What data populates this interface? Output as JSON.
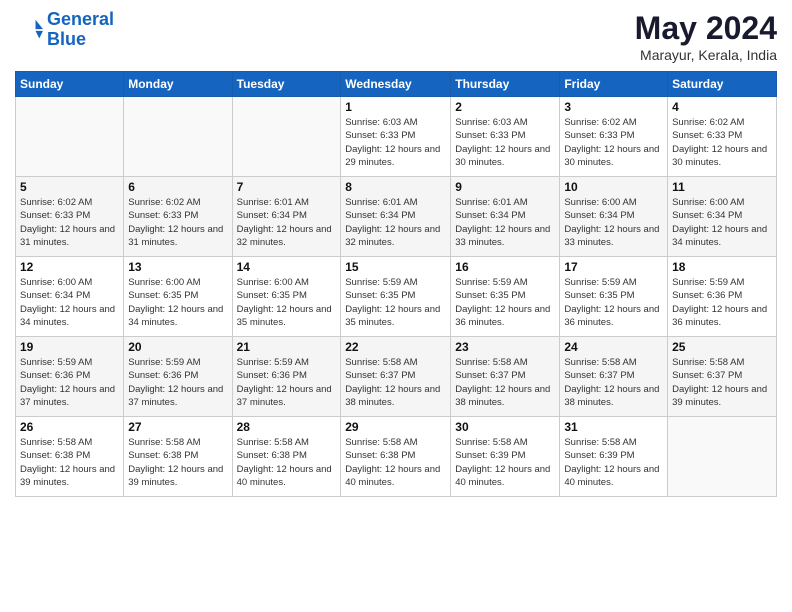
{
  "header": {
    "logo_line1": "General",
    "logo_line2": "Blue",
    "month_year": "May 2024",
    "location": "Marayur, Kerala, India"
  },
  "days_of_week": [
    "Sunday",
    "Monday",
    "Tuesday",
    "Wednesday",
    "Thursday",
    "Friday",
    "Saturday"
  ],
  "weeks": [
    [
      {
        "day": "",
        "info": ""
      },
      {
        "day": "",
        "info": ""
      },
      {
        "day": "",
        "info": ""
      },
      {
        "day": "1",
        "info": "Sunrise: 6:03 AM\nSunset: 6:33 PM\nDaylight: 12 hours\nand 29 minutes."
      },
      {
        "day": "2",
        "info": "Sunrise: 6:03 AM\nSunset: 6:33 PM\nDaylight: 12 hours\nand 30 minutes."
      },
      {
        "day": "3",
        "info": "Sunrise: 6:02 AM\nSunset: 6:33 PM\nDaylight: 12 hours\nand 30 minutes."
      },
      {
        "day": "4",
        "info": "Sunrise: 6:02 AM\nSunset: 6:33 PM\nDaylight: 12 hours\nand 30 minutes."
      }
    ],
    [
      {
        "day": "5",
        "info": "Sunrise: 6:02 AM\nSunset: 6:33 PM\nDaylight: 12 hours\nand 31 minutes."
      },
      {
        "day": "6",
        "info": "Sunrise: 6:02 AM\nSunset: 6:33 PM\nDaylight: 12 hours\nand 31 minutes."
      },
      {
        "day": "7",
        "info": "Sunrise: 6:01 AM\nSunset: 6:34 PM\nDaylight: 12 hours\nand 32 minutes."
      },
      {
        "day": "8",
        "info": "Sunrise: 6:01 AM\nSunset: 6:34 PM\nDaylight: 12 hours\nand 32 minutes."
      },
      {
        "day": "9",
        "info": "Sunrise: 6:01 AM\nSunset: 6:34 PM\nDaylight: 12 hours\nand 33 minutes."
      },
      {
        "day": "10",
        "info": "Sunrise: 6:00 AM\nSunset: 6:34 PM\nDaylight: 12 hours\nand 33 minutes."
      },
      {
        "day": "11",
        "info": "Sunrise: 6:00 AM\nSunset: 6:34 PM\nDaylight: 12 hours\nand 34 minutes."
      }
    ],
    [
      {
        "day": "12",
        "info": "Sunrise: 6:00 AM\nSunset: 6:34 PM\nDaylight: 12 hours\nand 34 minutes."
      },
      {
        "day": "13",
        "info": "Sunrise: 6:00 AM\nSunset: 6:35 PM\nDaylight: 12 hours\nand 34 minutes."
      },
      {
        "day": "14",
        "info": "Sunrise: 6:00 AM\nSunset: 6:35 PM\nDaylight: 12 hours\nand 35 minutes."
      },
      {
        "day": "15",
        "info": "Sunrise: 5:59 AM\nSunset: 6:35 PM\nDaylight: 12 hours\nand 35 minutes."
      },
      {
        "day": "16",
        "info": "Sunrise: 5:59 AM\nSunset: 6:35 PM\nDaylight: 12 hours\nand 36 minutes."
      },
      {
        "day": "17",
        "info": "Sunrise: 5:59 AM\nSunset: 6:35 PM\nDaylight: 12 hours\nand 36 minutes."
      },
      {
        "day": "18",
        "info": "Sunrise: 5:59 AM\nSunset: 6:36 PM\nDaylight: 12 hours\nand 36 minutes."
      }
    ],
    [
      {
        "day": "19",
        "info": "Sunrise: 5:59 AM\nSunset: 6:36 PM\nDaylight: 12 hours\nand 37 minutes."
      },
      {
        "day": "20",
        "info": "Sunrise: 5:59 AM\nSunset: 6:36 PM\nDaylight: 12 hours\nand 37 minutes."
      },
      {
        "day": "21",
        "info": "Sunrise: 5:59 AM\nSunset: 6:36 PM\nDaylight: 12 hours\nand 37 minutes."
      },
      {
        "day": "22",
        "info": "Sunrise: 5:58 AM\nSunset: 6:37 PM\nDaylight: 12 hours\nand 38 minutes."
      },
      {
        "day": "23",
        "info": "Sunrise: 5:58 AM\nSunset: 6:37 PM\nDaylight: 12 hours\nand 38 minutes."
      },
      {
        "day": "24",
        "info": "Sunrise: 5:58 AM\nSunset: 6:37 PM\nDaylight: 12 hours\nand 38 minutes."
      },
      {
        "day": "25",
        "info": "Sunrise: 5:58 AM\nSunset: 6:37 PM\nDaylight: 12 hours\nand 39 minutes."
      }
    ],
    [
      {
        "day": "26",
        "info": "Sunrise: 5:58 AM\nSunset: 6:38 PM\nDaylight: 12 hours\nand 39 minutes."
      },
      {
        "day": "27",
        "info": "Sunrise: 5:58 AM\nSunset: 6:38 PM\nDaylight: 12 hours\nand 39 minutes."
      },
      {
        "day": "28",
        "info": "Sunrise: 5:58 AM\nSunset: 6:38 PM\nDaylight: 12 hours\nand 40 minutes."
      },
      {
        "day": "29",
        "info": "Sunrise: 5:58 AM\nSunset: 6:38 PM\nDaylight: 12 hours\nand 40 minutes."
      },
      {
        "day": "30",
        "info": "Sunrise: 5:58 AM\nSunset: 6:39 PM\nDaylight: 12 hours\nand 40 minutes."
      },
      {
        "day": "31",
        "info": "Sunrise: 5:58 AM\nSunset: 6:39 PM\nDaylight: 12 hours\nand 40 minutes."
      },
      {
        "day": "",
        "info": ""
      }
    ]
  ]
}
